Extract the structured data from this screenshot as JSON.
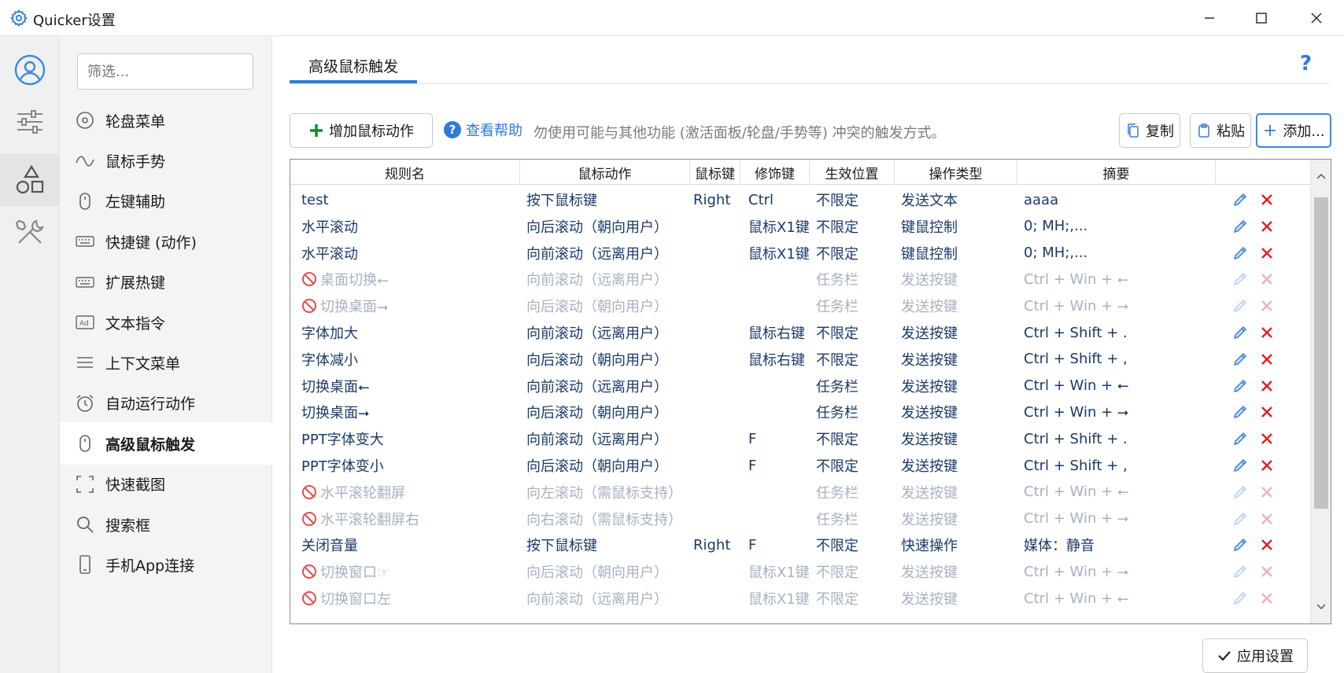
{
  "window": {
    "title": "Quicker设置",
    "minimize_icon": "minimize-icon",
    "maximize_icon": "maximize-icon",
    "close_icon": "close-icon"
  },
  "rail": {
    "items": [
      {
        "name": "user",
        "icon": "user-circle-icon"
      },
      {
        "name": "settings",
        "icon": "sliders-icon"
      },
      {
        "name": "shapes",
        "icon": "shapes-icon",
        "active": true
      },
      {
        "name": "tools",
        "icon": "tools-icon"
      }
    ]
  },
  "nav": {
    "filter_placeholder": "筛选...",
    "items": [
      {
        "label": "轮盘菜单",
        "icon": "wheel-icon"
      },
      {
        "label": "鼠标手势",
        "icon": "gesture-icon"
      },
      {
        "label": "左键辅助",
        "icon": "mouse-icon"
      },
      {
        "label": "快捷键 (动作)",
        "icon": "keyboard-icon"
      },
      {
        "label": "扩展热键",
        "icon": "keyboard-icon"
      },
      {
        "label": "文本指令",
        "icon": "text-ad-icon"
      },
      {
        "label": "上下文菜单",
        "icon": "menu-lines-icon"
      },
      {
        "label": "自动运行动作",
        "icon": "alarm-icon"
      },
      {
        "label": "高级鼠标触发",
        "icon": "mouse-icon",
        "active": true
      },
      {
        "label": "快速截图",
        "icon": "screenshot-icon"
      },
      {
        "label": "搜索框",
        "icon": "search-icon"
      },
      {
        "label": "手机App连接",
        "icon": "phone-icon"
      }
    ]
  },
  "main": {
    "tab_label": "高级鼠标触发",
    "help_icon": "help-question-icon",
    "add_action_label": "增加鼠标动作",
    "help_link_label": "查看帮助",
    "hint": "勿使用可能与其他功能 (激活面板/轮盘/手势等) 冲突的触发方式。",
    "copy_label": "复制",
    "paste_label": "粘贴",
    "add_label": "添加...",
    "apply_label": "应用设置"
  },
  "table": {
    "columns": [
      "规则名",
      "鼠标动作",
      "鼠标键",
      "修饰键",
      "生效位置",
      "操作类型",
      "摘要"
    ],
    "rows": [
      {
        "name": "test",
        "action": "按下鼠标键",
        "button": "Right",
        "modifier": "Ctrl",
        "scope": "不限定",
        "type": "发送文本",
        "summary": "aaaa",
        "disabled": false
      },
      {
        "name": "水平滚动",
        "action": "向后滚动（朝向用户）",
        "button": "",
        "modifier": "鼠标X1键",
        "scope": "不限定",
        "type": "键鼠控制",
        "summary": "0; MH;,...",
        "disabled": false
      },
      {
        "name": "水平滚动",
        "action": "向前滚动（远离用户）",
        "button": "",
        "modifier": "鼠标X1键",
        "scope": "不限定",
        "type": "键鼠控制",
        "summary": "0; MH;,...",
        "disabled": false
      },
      {
        "name": "桌面切换⭠",
        "action": "向前滚动（远离用户）",
        "button": "",
        "modifier": "",
        "scope": "任务栏",
        "type": "发送按键",
        "summary": "Ctrl + Win + ⭠",
        "disabled": true
      },
      {
        "name": "切换桌面⭢",
        "action": "向后滚动（朝向用户）",
        "button": "",
        "modifier": "",
        "scope": "任务栏",
        "type": "发送按键",
        "summary": "Ctrl + Win + ⭢",
        "disabled": true
      },
      {
        "name": "字体加大",
        "action": "向前滚动（远离用户）",
        "button": "",
        "modifier": "鼠标右键",
        "scope": "不限定",
        "type": "发送按键",
        "summary": "Ctrl + Shift + .",
        "disabled": false
      },
      {
        "name": "字体减小",
        "action": "向后滚动（朝向用户）",
        "button": "",
        "modifier": "鼠标右键",
        "scope": "不限定",
        "type": "发送按键",
        "summary": "Ctrl + Shift + ,",
        "disabled": false
      },
      {
        "name": "切换桌面⭠",
        "action": "向前滚动（远离用户）",
        "button": "",
        "modifier": "",
        "scope": "任务栏",
        "type": "发送按键",
        "summary": "Ctrl + Win + ⭠",
        "disabled": false
      },
      {
        "name": "切换桌面⭢",
        "action": "向后滚动（朝向用户）",
        "button": "",
        "modifier": "",
        "scope": "任务栏",
        "type": "发送按键",
        "summary": "Ctrl + Win + ⭢",
        "disabled": false
      },
      {
        "name": "PPT字体变大",
        "action": "向前滚动（远离用户）",
        "button": "",
        "modifier": "F",
        "scope": "不限定",
        "type": "发送按键",
        "summary": "Ctrl + Shift + .",
        "disabled": false
      },
      {
        "name": "PPT字体变小",
        "action": "向后滚动（朝向用户）",
        "button": "",
        "modifier": "F",
        "scope": "不限定",
        "type": "发送按键",
        "summary": "Ctrl + Shift + ,",
        "disabled": false
      },
      {
        "name": "水平滚轮翻屏",
        "action": "向左滚动（需鼠标支持）",
        "button": "",
        "modifier": "",
        "scope": "任务栏",
        "type": "发送按键",
        "summary": "Ctrl + Win + ⭠",
        "disabled": true
      },
      {
        "name": "水平滚轮翻屏右",
        "action": "向右滚动（需鼠标支持）",
        "button": "",
        "modifier": "",
        "scope": "任务栏",
        "type": "发送按键",
        "summary": "Ctrl + Win + ⭢",
        "disabled": true
      },
      {
        "name": "关闭音量",
        "action": "按下鼠标键",
        "button": "Right",
        "modifier": "F",
        "scope": "不限定",
        "type": "快速操作",
        "summary": "媒体：静音",
        "disabled": false
      },
      {
        "name": "切换窗口☞",
        "action": "向后滚动（朝向用户）",
        "button": "",
        "modifier": "鼠标X1键",
        "scope": "不限定",
        "type": "发送按键",
        "summary": "Ctrl + Win + ⭢",
        "disabled": true
      },
      {
        "name": "切换窗口左",
        "action": "向前滚动（远离用户）",
        "button": "",
        "modifier": "鼠标X1键",
        "scope": "不限定",
        "type": "发送按键",
        "summary": "Ctrl + Win + ⭠",
        "disabled": true
      }
    ]
  },
  "colors": {
    "accent": "#2e7bd6",
    "delete": "#e02020",
    "edit": "#3a7bd5",
    "disabled_text": "#a7b1c0",
    "row_text": "#1a3a66"
  }
}
